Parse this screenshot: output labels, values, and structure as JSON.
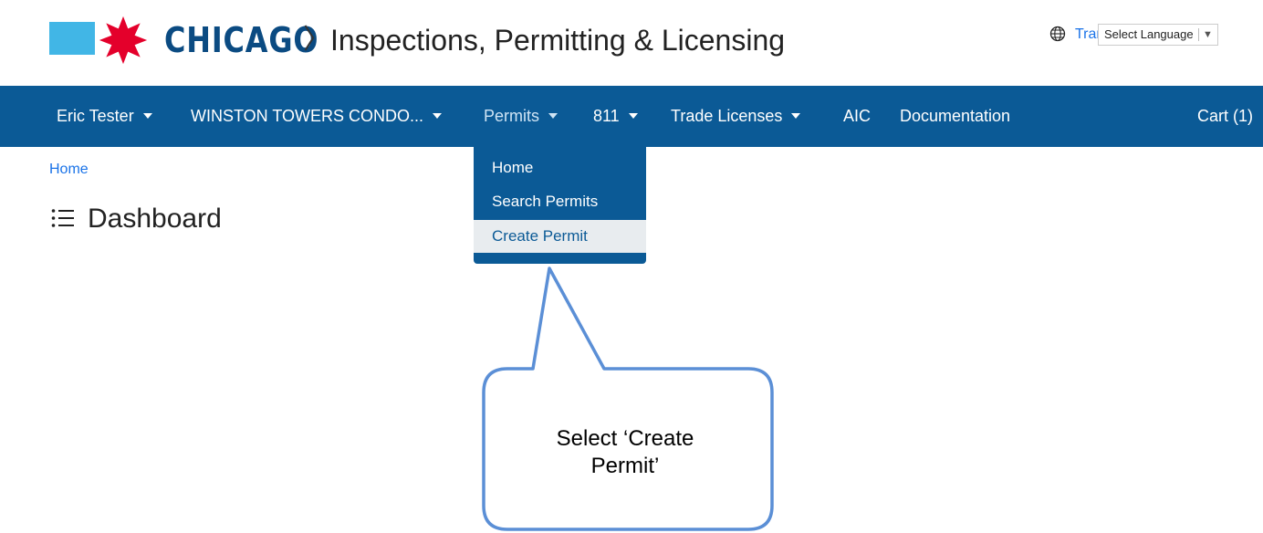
{
  "header": {
    "logo_text": "CHICAGO",
    "separator": "〉",
    "app_title": "Inspections, Permitting & Licensing",
    "translate_label": "Translate",
    "language_select": "Select Language",
    "colors": {
      "logo_blue": "#41b6e6",
      "star_red": "#e4002b",
      "brand_navy": "#0b4b82"
    }
  },
  "navbar": {
    "items": [
      {
        "label": "Eric Tester",
        "dropdown": true
      },
      {
        "label": "WINSTON TOWERS CONDO...",
        "dropdown": true
      },
      {
        "label": "Permits",
        "dropdown": true,
        "active": true
      },
      {
        "label": "811",
        "dropdown": true
      },
      {
        "label": "Trade Licenses",
        "dropdown": true
      },
      {
        "label": "AIC",
        "dropdown": false
      },
      {
        "label": "Documentation",
        "dropdown": false
      }
    ],
    "cart_label": "Cart (1)",
    "color": "#0b5a96"
  },
  "breadcrumb": {
    "home": "Home"
  },
  "page": {
    "title": "Dashboard",
    "icon": "list-icon"
  },
  "permits_menu": {
    "items": [
      {
        "label": "Home"
      },
      {
        "label": "Search Permits"
      },
      {
        "label": "Create Permit",
        "highlighted": true
      }
    ]
  },
  "callout": {
    "text": "Select ‘Create Permit’",
    "line1": "Select ‘Create",
    "line2": "Permit’"
  }
}
